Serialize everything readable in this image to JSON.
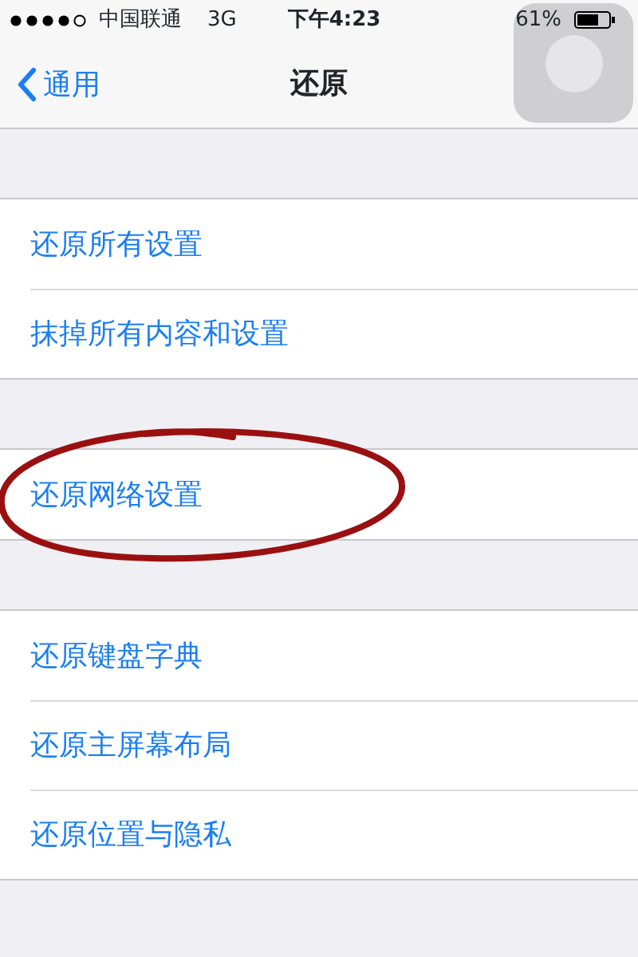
{
  "status_bar": {
    "carrier": "中国联通",
    "network": "3G",
    "time": "下午4:23",
    "battery": "61%"
  },
  "nav": {
    "back": "通用",
    "title": "还原"
  },
  "groups": [
    {
      "items": [
        {
          "label": "还原所有设置",
          "circled": false
        },
        {
          "label": "抹掉所有内容和设置",
          "circled": false
        }
      ]
    },
    {
      "items": [
        {
          "label": "还原网络设置",
          "circled": true
        }
      ]
    },
    {
      "items": [
        {
          "label": "还原键盘字典",
          "circled": false
        },
        {
          "label": "还原主屏幕布局",
          "circled": false
        },
        {
          "label": "还原位置与隐私",
          "circled": false
        }
      ]
    }
  ]
}
